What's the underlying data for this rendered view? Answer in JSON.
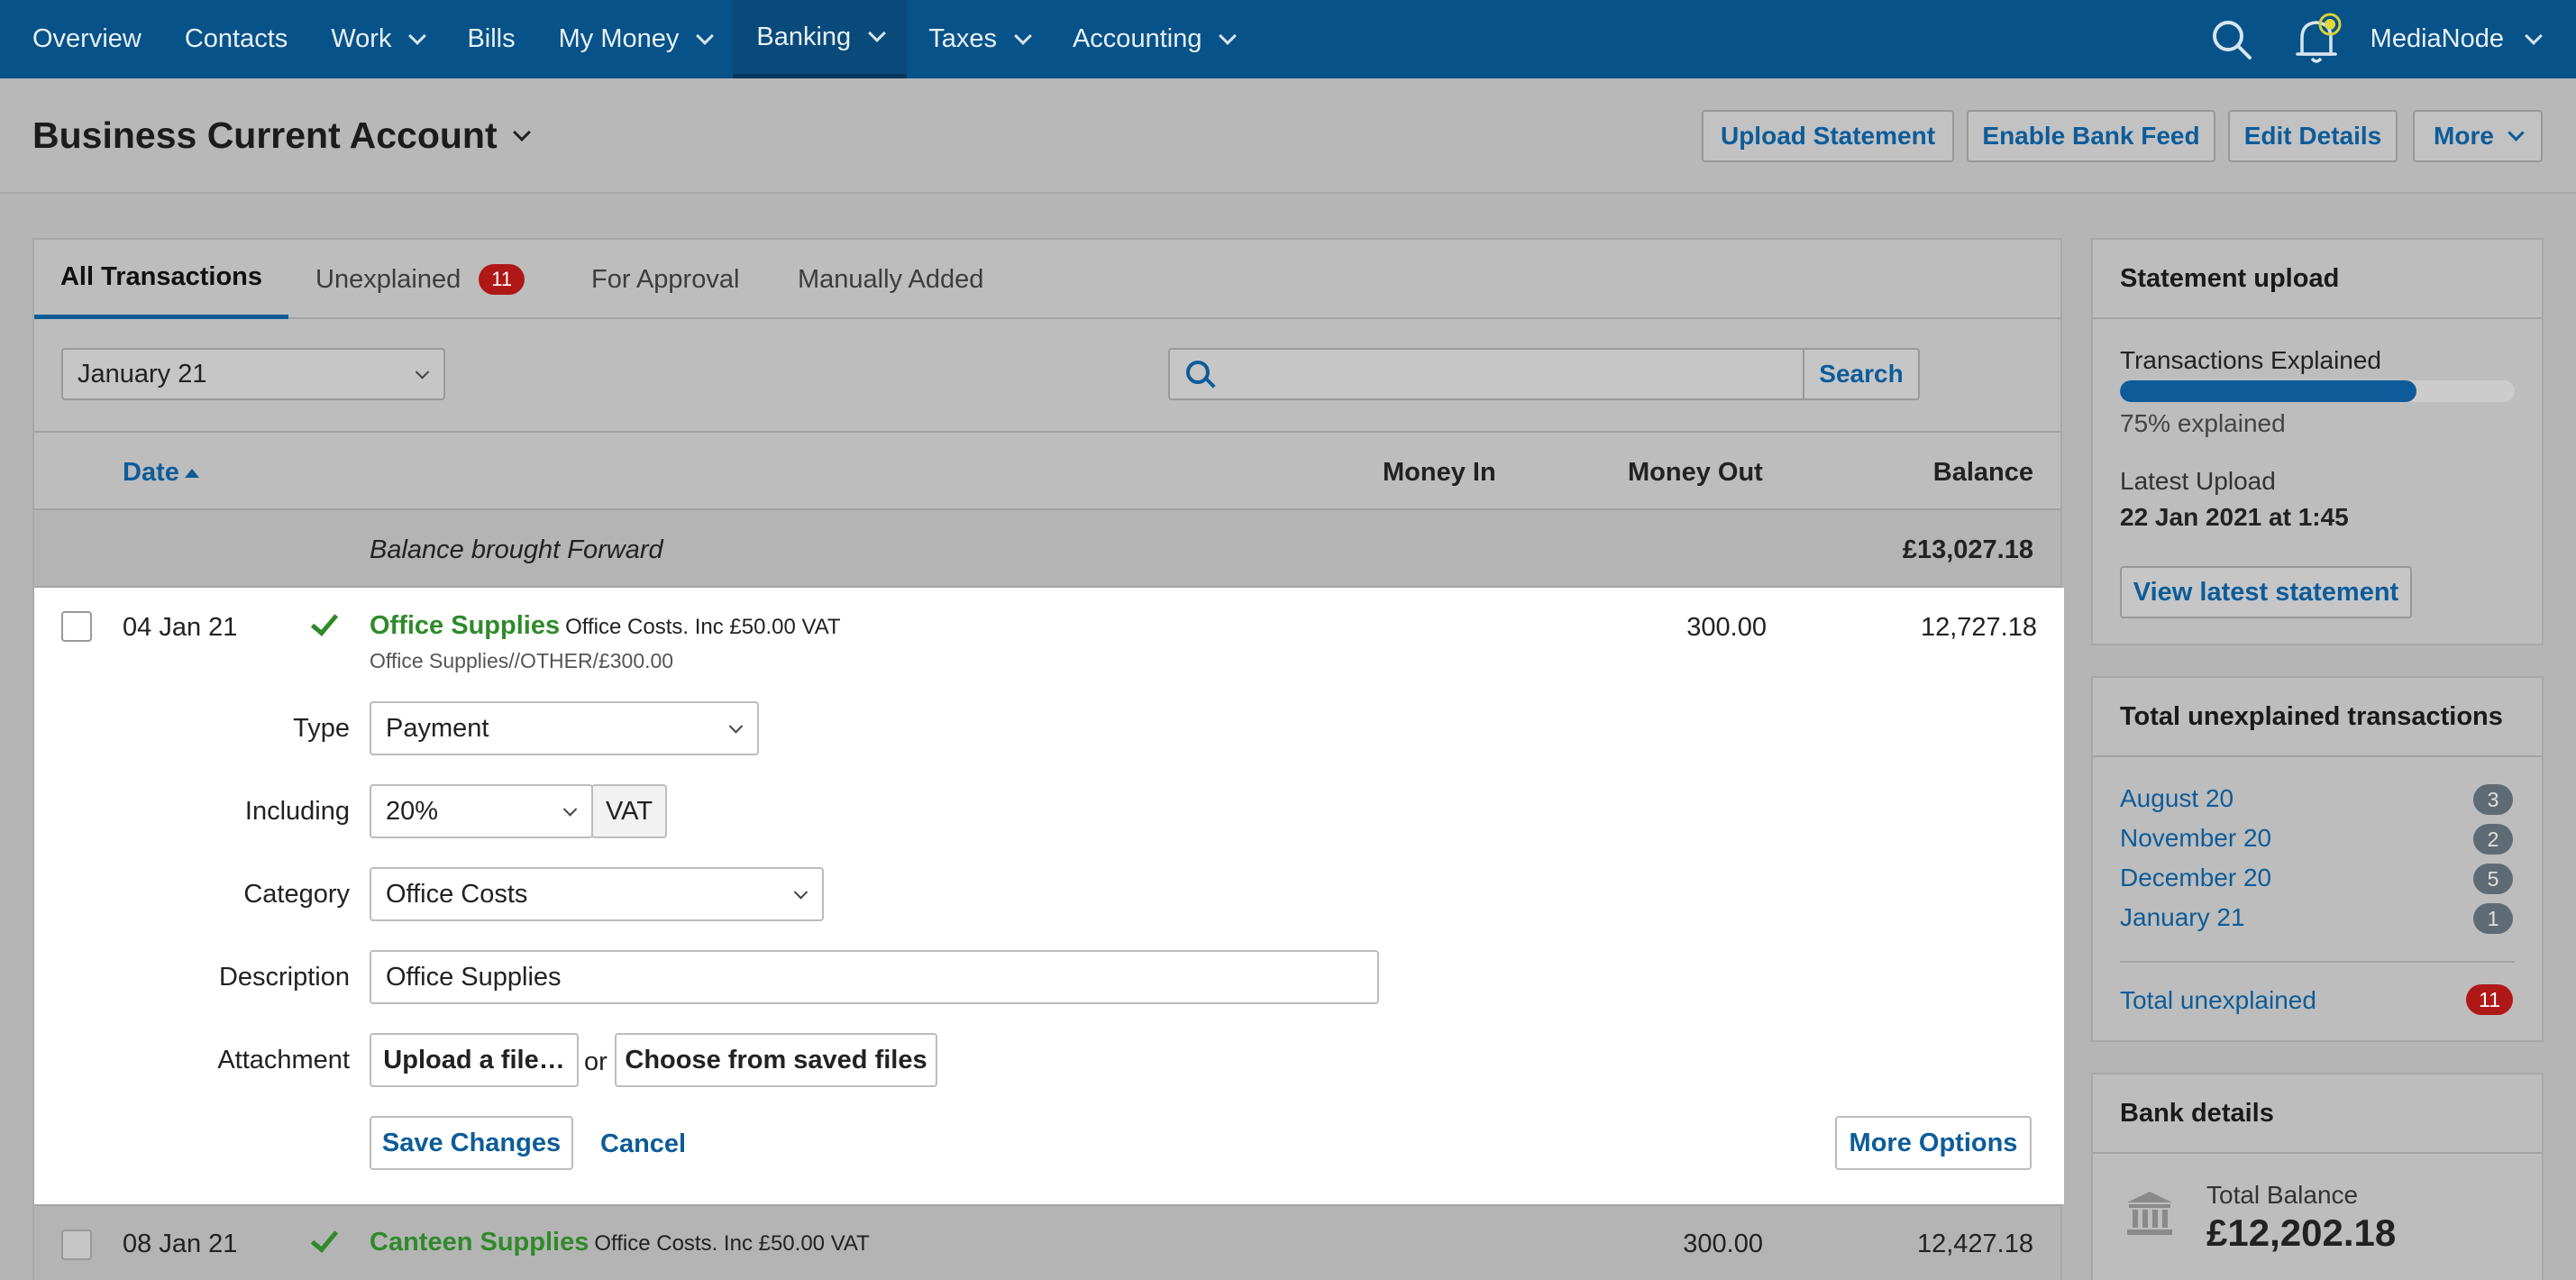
{
  "nav": {
    "items": [
      {
        "label": "Overview",
        "dropdown": false
      },
      {
        "label": "Contacts",
        "dropdown": false
      },
      {
        "label": "Work",
        "dropdown": true
      },
      {
        "label": "Bills",
        "dropdown": false
      },
      {
        "label": "My Money",
        "dropdown": true
      },
      {
        "label": "Banking",
        "dropdown": true,
        "active": true
      },
      {
        "label": "Taxes",
        "dropdown": true
      },
      {
        "label": "Accounting",
        "dropdown": true
      }
    ],
    "org_name": "MediaNode"
  },
  "header": {
    "title": "Business Current Account",
    "buttons": {
      "upload_statement": "Upload Statement",
      "enable_bank_feed": "Enable Bank Feed",
      "edit_details": "Edit Details",
      "more": "More"
    }
  },
  "tabs": {
    "all": "All Transactions",
    "unexplained": "Unexplained",
    "unexplained_count": "11",
    "for_approval": "For Approval",
    "manually_added": "Manually Added"
  },
  "filter": {
    "month": "January 21",
    "search_placeholder": "",
    "search_button": "Search"
  },
  "columns": {
    "date": "Date",
    "money_in": "Money In",
    "money_out": "Money Out",
    "balance": "Balance"
  },
  "balance_forward": {
    "label": "Balance brought Forward",
    "balance": "£13,027.18"
  },
  "transactions": [
    {
      "date": "04 Jan 21",
      "name": "Office Supplies",
      "detail": "Office Costs. Inc £50.00 VAT",
      "reference": "Office Supplies//OTHER/£300.00",
      "money_out": "300.00",
      "balance": "12,727.18"
    },
    {
      "date": "08 Jan 21",
      "name": "Canteen Supplies",
      "detail": "Office Costs. Inc £50.00 VAT",
      "money_out": "300.00",
      "balance": "12,427.18"
    }
  ],
  "form": {
    "type_label": "Type",
    "type_value": "Payment",
    "including_label": "Including",
    "vat_rate": "20%",
    "vat_suffix": "VAT",
    "category_label": "Category",
    "category_value": "Office Costs",
    "description_label": "Description",
    "description_value": "Office Supplies",
    "attachment_label": "Attachment",
    "upload_button": "Upload a file…",
    "or_text": "or",
    "choose_saved_button": "Choose from saved files",
    "save_button": "Save Changes",
    "cancel_link": "Cancel",
    "more_options_button": "More Options"
  },
  "statement_upload": {
    "title": "Statement upload",
    "explained_label": "Transactions Explained",
    "explained_fraction": 0.75,
    "explained_text": "75% explained",
    "latest_upload_label": "Latest Upload",
    "latest_upload_value": "22 Jan 2021 at 1:45",
    "view_button": "View latest statement"
  },
  "unexplained_card": {
    "title": "Total unexplained transactions",
    "months": [
      {
        "label": "August 20",
        "count": "3"
      },
      {
        "label": "November 20",
        "count": "2"
      },
      {
        "label": "December 20",
        "count": "5"
      },
      {
        "label": "January 21",
        "count": "1"
      }
    ],
    "total_label": "Total unexplained",
    "total_count": "11"
  },
  "bank_details": {
    "title": "Bank details",
    "balance_label": "Total Balance",
    "balance_value": "£12,202.18"
  },
  "colors": {
    "nav_bg": "#075288",
    "accent": "#0d5c99",
    "success": "#2f8a2a",
    "danger": "#b01818"
  }
}
